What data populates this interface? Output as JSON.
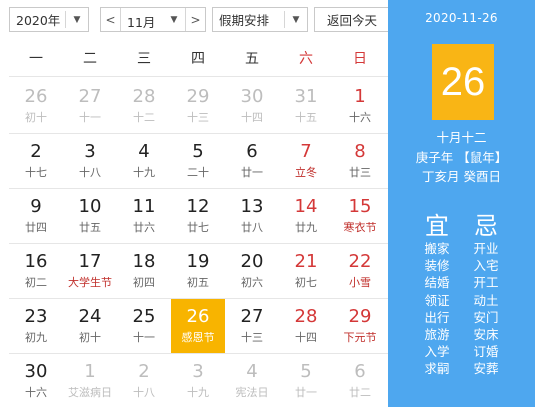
{
  "toolbar": {
    "year": "2020年",
    "month": "11月",
    "holiday": "假期安排",
    "today": "返回今天",
    "prev_icon": "chevron-left-icon",
    "next_icon": "chevron-right-icon",
    "dropdown_icon": "caret-down-icon"
  },
  "weekdays": [
    "一",
    "二",
    "三",
    "四",
    "五",
    "六",
    "日"
  ],
  "days": [
    {
      "d": "26",
      "l": "初十",
      "other": true
    },
    {
      "d": "27",
      "l": "十一",
      "other": true
    },
    {
      "d": "28",
      "l": "十二",
      "other": true
    },
    {
      "d": "29",
      "l": "十三",
      "other": true
    },
    {
      "d": "30",
      "l": "十四",
      "other": true
    },
    {
      "d": "31",
      "l": "十五",
      "other": true
    },
    {
      "d": "1",
      "l": "十六"
    },
    {
      "d": "2",
      "l": "十七"
    },
    {
      "d": "3",
      "l": "十八"
    },
    {
      "d": "4",
      "l": "十九"
    },
    {
      "d": "5",
      "l": "二十"
    },
    {
      "d": "6",
      "l": "廿一"
    },
    {
      "d": "7",
      "l": "立冬",
      "fest": true
    },
    {
      "d": "8",
      "l": "廿三"
    },
    {
      "d": "9",
      "l": "廿四"
    },
    {
      "d": "10",
      "l": "廿五"
    },
    {
      "d": "11",
      "l": "廿六"
    },
    {
      "d": "12",
      "l": "廿七"
    },
    {
      "d": "13",
      "l": "廿八"
    },
    {
      "d": "14",
      "l": "廿九"
    },
    {
      "d": "15",
      "l": "寒衣节",
      "fest": true
    },
    {
      "d": "16",
      "l": "初二"
    },
    {
      "d": "17",
      "l": "大学生节",
      "fest": true
    },
    {
      "d": "18",
      "l": "初四"
    },
    {
      "d": "19",
      "l": "初五"
    },
    {
      "d": "20",
      "l": "初六"
    },
    {
      "d": "21",
      "l": "初七"
    },
    {
      "d": "22",
      "l": "小雪",
      "fest": true
    },
    {
      "d": "23",
      "l": "初九"
    },
    {
      "d": "24",
      "l": "初十"
    },
    {
      "d": "25",
      "l": "十一"
    },
    {
      "d": "26",
      "l": "感恩节",
      "selected": true
    },
    {
      "d": "27",
      "l": "十三"
    },
    {
      "d": "28",
      "l": "十四"
    },
    {
      "d": "29",
      "l": "下元节",
      "fest": true
    },
    {
      "d": "30",
      "l": "十六"
    },
    {
      "d": "1",
      "l": "艾滋病日",
      "other": true
    },
    {
      "d": "2",
      "l": "十八",
      "other": true
    },
    {
      "d": "3",
      "l": "十九",
      "other": true
    },
    {
      "d": "4",
      "l": "宪法日",
      "other": true
    },
    {
      "d": "5",
      "l": "廿一",
      "other": true
    },
    {
      "d": "6",
      "l": "廿二",
      "other": true
    }
  ],
  "side": {
    "date": "2020-11-26",
    "day": "26",
    "lunar": "十月十二",
    "ganzhi_year": "庚子年 【鼠年】",
    "ganzhi_day": "丁亥月 癸酉日",
    "yi_label": "宜",
    "ji_label": "忌",
    "yi": [
      "搬家",
      "装修",
      "结婚",
      "领证",
      "出行",
      "旅游",
      "入学",
      "求嗣"
    ],
    "ji": [
      "开业",
      "入宅",
      "开工",
      "动土",
      "安门",
      "安床",
      "订婚",
      "安葬"
    ]
  },
  "colors": {
    "panel_blue": "#4ea7ef",
    "selected_orange": "#f8b400",
    "weekend_red": "#d43838"
  }
}
